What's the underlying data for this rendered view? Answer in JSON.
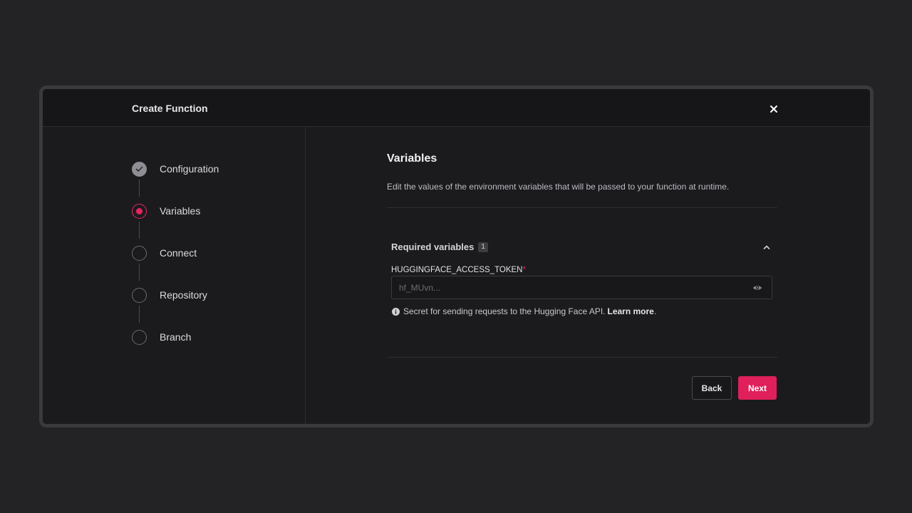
{
  "modal": {
    "title": "Create Function",
    "close_icon": "close-icon"
  },
  "steps": [
    {
      "label": "Configuration",
      "state": "completed"
    },
    {
      "label": "Variables",
      "state": "active"
    },
    {
      "label": "Connect",
      "state": "pending"
    },
    {
      "label": "Repository",
      "state": "pending"
    },
    {
      "label": "Branch",
      "state": "pending"
    }
  ],
  "main": {
    "title": "Variables",
    "description": "Edit the values of the environment variables that will be passed to your function at runtime.",
    "required_section": {
      "title": "Required variables",
      "count": "1",
      "expanded": true
    },
    "variable": {
      "name": "HUGGINGFACE_ACCESS_TOKEN",
      "required_marker": "*",
      "value": "",
      "placeholder": "hf_MUvn...",
      "hint": "Secret for sending requests to the Hugging Face API.",
      "hint_link": "Learn more",
      "hint_suffix": "."
    }
  },
  "buttons": {
    "back": "Back",
    "next": "Next"
  },
  "colors": {
    "accent": "#e0205a",
    "background": "#232325",
    "modal": "#1b1b1e"
  }
}
